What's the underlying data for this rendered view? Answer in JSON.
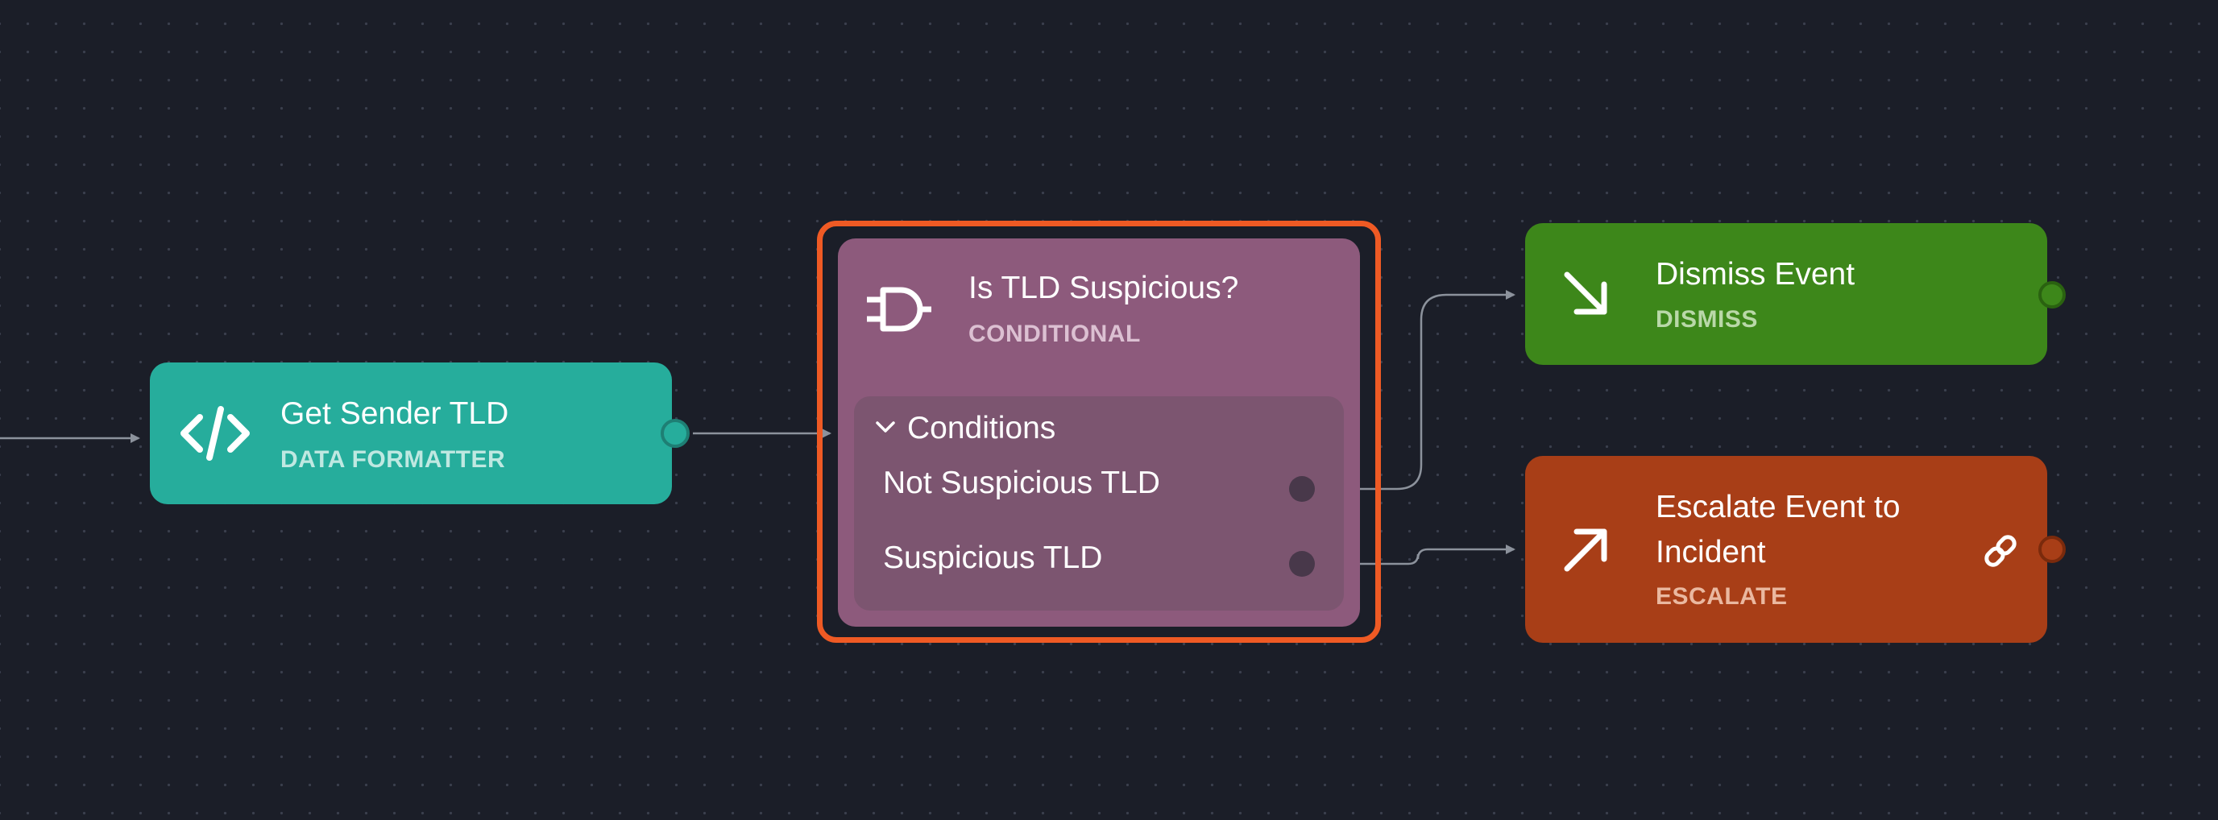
{
  "colors": {
    "canvas_bg": "#1b1e28",
    "data_formatter": "#26ad9c",
    "conditional": "#8d5a7c",
    "dismiss": "#3d871a",
    "escalate": "#a83e17",
    "selection": "#ef5a24",
    "edge": "#8c929c"
  },
  "nodes": {
    "get_sender": {
      "title": "Get Sender TLD",
      "type": "DATA FORMATTER",
      "icon": "code-icon"
    },
    "conditional": {
      "title": "Is TLD Suspicious?",
      "type": "CONDITIONAL",
      "icon": "logic-gate-icon",
      "conditions_label": "Conditions",
      "conditions": [
        "Not Suspicious TLD",
        "Suspicious TLD"
      ]
    },
    "dismiss": {
      "title": "Dismiss Event",
      "type": "DISMISS",
      "icon": "arrow-down-right-icon"
    },
    "escalate": {
      "title_line1": "Escalate Event to",
      "title_line2": "Incident",
      "type": "ESCALATE",
      "icon": "arrow-up-right-icon",
      "link_icon": "link-icon"
    }
  }
}
